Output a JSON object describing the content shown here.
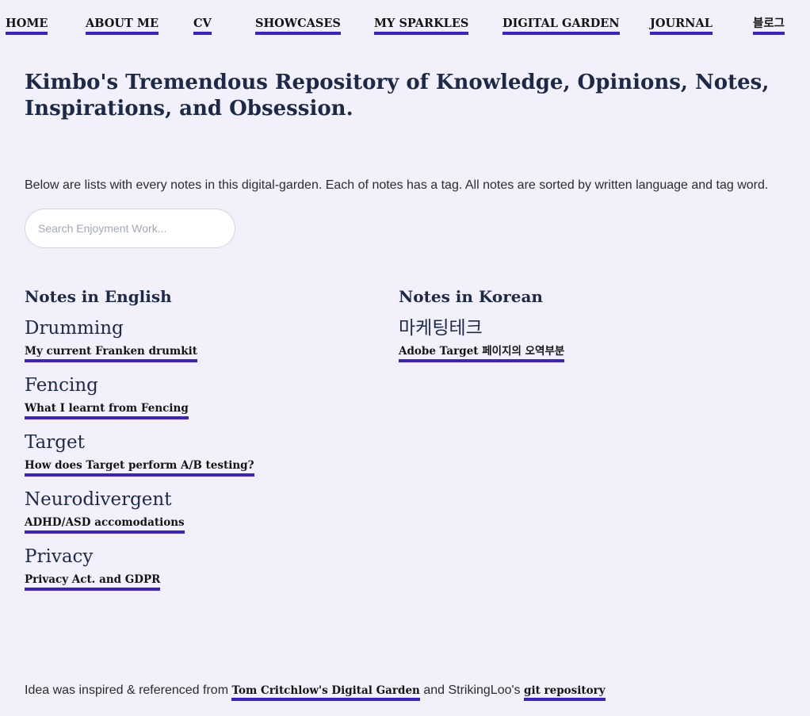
{
  "nav": {
    "items": [
      {
        "label": "HOME"
      },
      {
        "label": "ABOUT ME"
      },
      {
        "label": "CV"
      },
      {
        "label": "SHOWCASES"
      },
      {
        "label": "MY SPARKLES"
      },
      {
        "label": "DIGITAL GARDEN"
      },
      {
        "label": "JOURNAL"
      },
      {
        "label": "블로그"
      }
    ]
  },
  "page": {
    "title": "Kimbo's Tremendous Repository of Knowledge, Opinions, Notes, Inspirations, and Obsession.",
    "intro": "Below are lists with every notes in this digital-garden. Each of notes has a tag. All notes are sorted by written language and tag word."
  },
  "search": {
    "placeholder": "Search Enjoyment Work..."
  },
  "english": {
    "heading": "Notes in English",
    "groups": [
      {
        "tag": "Drumming",
        "note": "My current Franken drumkit"
      },
      {
        "tag": "Fencing",
        "note": "What I learnt from Fencing"
      },
      {
        "tag": "Target",
        "note": "How does Target perform A/B testing?"
      },
      {
        "tag": "Neurodivergent",
        "note": "ADHD/ASD accomodations"
      },
      {
        "tag": "Privacy",
        "note": "Privacy Act. and GDPR"
      }
    ]
  },
  "korean": {
    "heading": "Notes in Korean",
    "groups": [
      {
        "tag": "마케팅테크",
        "note": "Adobe Target 페이지의 오역부분"
      }
    ]
  },
  "footer": {
    "prefix": "Idea was inspired & referenced from",
    "link1": "Tom Critchlow's Digital Garden",
    "middle": "and StrikingLoo's",
    "link2": "git repository"
  },
  "colors": {
    "accent": "#3c22c6",
    "background": "#f2f0fa",
    "heading": "#1c2a48"
  }
}
